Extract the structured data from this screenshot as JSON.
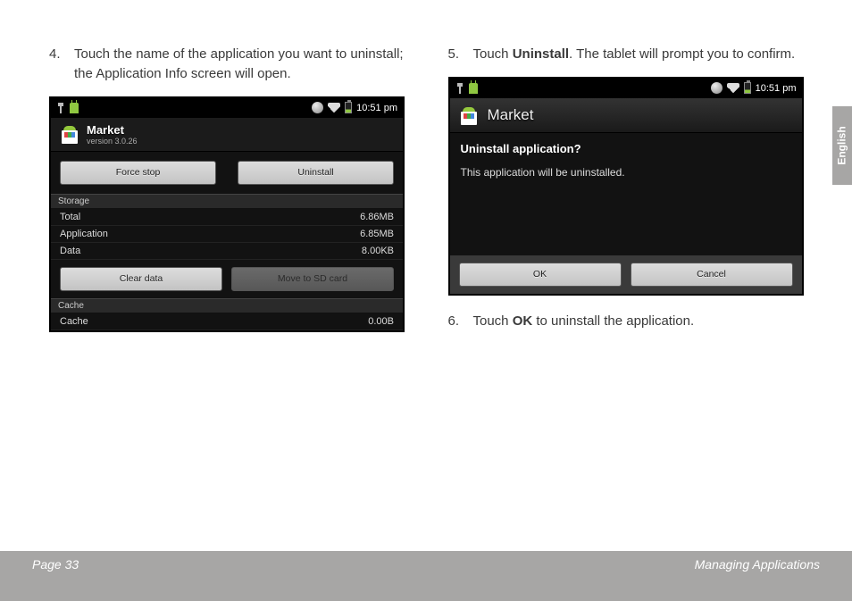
{
  "steps": {
    "s4": {
      "num": "4.",
      "text_a": "Touch the name of the application you want to uninstall; the Application Info screen will open."
    },
    "s5": {
      "num": "5.",
      "text_a": "Touch ",
      "bold": "Uninstall",
      "text_b": ". The tablet will prompt you to confirm."
    },
    "s6": {
      "num": "6.",
      "text_a": "Touch ",
      "bold": "OK",
      "text_b": " to uninstall the application."
    }
  },
  "status": {
    "time": "10:51 pm"
  },
  "shot1": {
    "app_name": "Market",
    "app_version": "version 3.0.26",
    "btn_force_stop": "Force stop",
    "btn_uninstall": "Uninstall",
    "section_storage": "Storage",
    "rows": {
      "total": {
        "label": "Total",
        "value": "6.86MB"
      },
      "application": {
        "label": "Application",
        "value": "6.85MB"
      },
      "data": {
        "label": "Data",
        "value": "8.00KB"
      }
    },
    "btn_clear_data": "Clear data",
    "btn_move_sd": "Move to SD card",
    "section_cache": "Cache",
    "row_cache": {
      "label": "Cache",
      "value": "0.00B"
    }
  },
  "shot2": {
    "title": "Market",
    "question": "Uninstall application?",
    "body": "This application will be uninstalled.",
    "btn_ok": "OK",
    "btn_cancel": "Cancel"
  },
  "footer": {
    "page": "Page 33",
    "section": "Managing Applications"
  },
  "lang": "English"
}
